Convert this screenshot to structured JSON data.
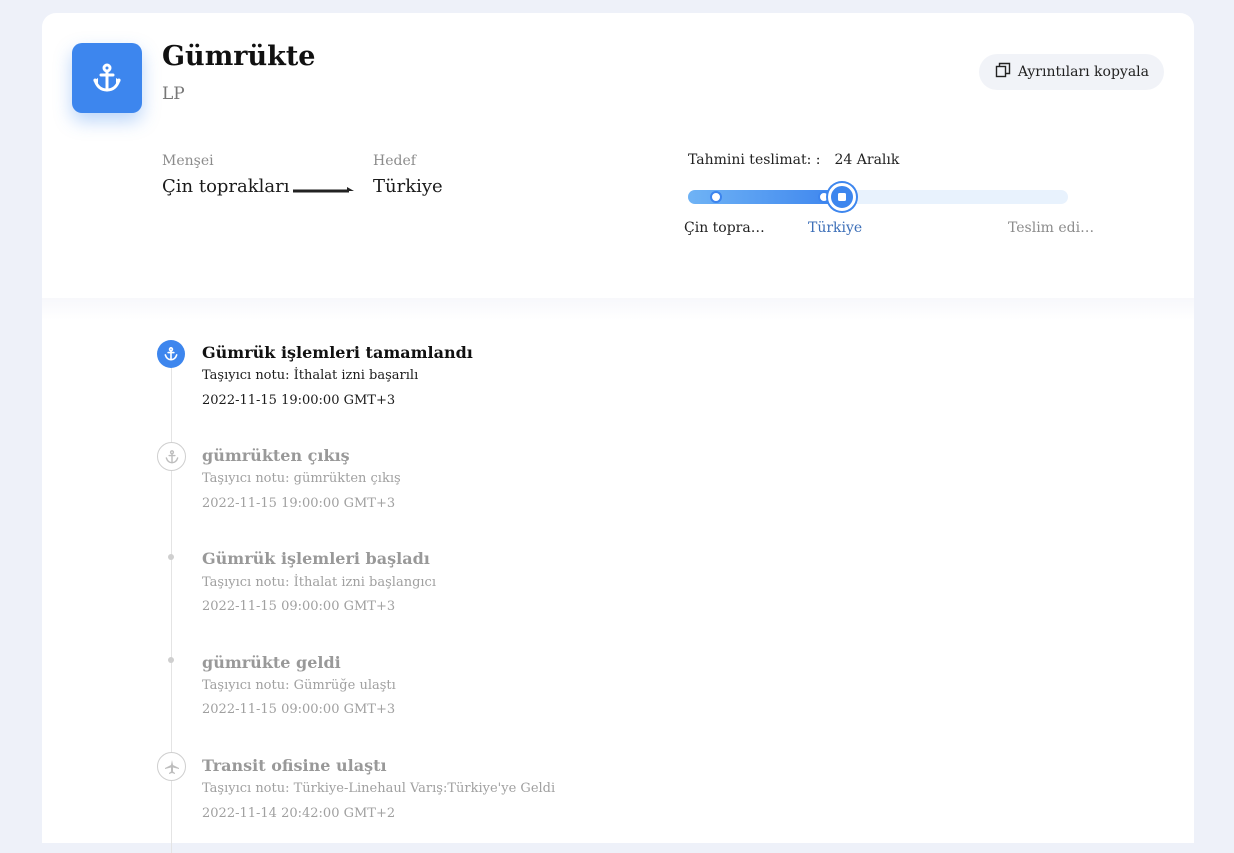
{
  "header": {
    "title": "Gümrükte",
    "tracking_number": "LP",
    "copy_button_label": "Ayrıntıları kopyala",
    "app_icon": "anchor-icon"
  },
  "route": {
    "origin_label": "Menşei",
    "origin_value": "Çin toprakları",
    "destination_label": "Hedef",
    "destination_value": "Türkiye"
  },
  "delivery": {
    "eta_label": "Tahmini teslimat: :",
    "eta_value": "24 Aralık",
    "progress_fraction": 0.41,
    "stages": [
      {
        "label": "Çin topra…",
        "state": "done"
      },
      {
        "label": "Türkiye",
        "state": "current"
      },
      {
        "label": "Teslim edi…",
        "state": "pending"
      }
    ]
  },
  "events": [
    {
      "title": "Gümrük işlemleri tamamlandı",
      "note": "Taşıyıcı notu: İthalat izni başarılı",
      "time": "2022-11-15 19:00:00 GMT+3",
      "icon": "anchor-icon",
      "state": "current"
    },
    {
      "title": "gümrükten çıkış",
      "note": "Taşıyıcı notu: gümrükten çıkış",
      "time": "2022-11-15 19:00:00 GMT+3",
      "icon": "anchor-icon",
      "state": "past"
    },
    {
      "title": "Gümrük işlemleri başladı",
      "note": "Taşıyıcı notu: İthalat izni başlangıcı",
      "time": "2022-11-15 09:00:00 GMT+3",
      "icon": "dot",
      "state": "past"
    },
    {
      "title": "gümrükte geldi",
      "note": "Taşıyıcı notu: Gümrüğe ulaştı",
      "time": "2022-11-15 09:00:00 GMT+3",
      "icon": "dot",
      "state": "past"
    },
    {
      "title": "Transit ofisine ulaştı",
      "note": "Taşıyıcı notu: Türkiye-Linehaul Varış:Türkiye'ye Geldi",
      "time": "2022-11-14 20:42:00 GMT+2",
      "icon": "airplane-icon",
      "state": "past"
    }
  ],
  "colors": {
    "accent": "#3d86ee",
    "page_bg": "#eef1f9",
    "muted_text": "#a0a0a0"
  }
}
